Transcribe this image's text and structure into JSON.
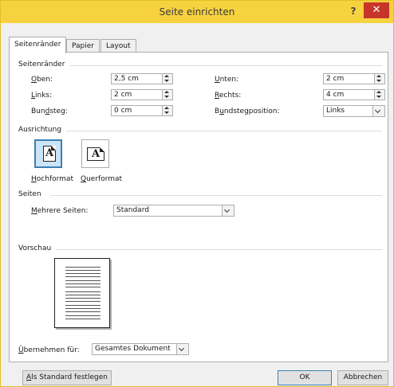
{
  "window": {
    "title": "Seite einrichten",
    "help_label": "?",
    "close_label": "✕"
  },
  "tabs": [
    {
      "label": "Seitenränder",
      "active": true
    },
    {
      "label": "Papier",
      "active": false
    },
    {
      "label": "Layout",
      "active": false
    }
  ],
  "margins": {
    "section": "Seitenränder",
    "top": {
      "label_u": "O",
      "label_rest": "ben:",
      "value": "2,5 cm"
    },
    "left": {
      "label_u": "L",
      "label_rest": "inks:",
      "value": "2 cm"
    },
    "gutter": {
      "label_pre": "Bun",
      "label_u": "d",
      "label_rest": "steg:",
      "value": "0 cm"
    },
    "bottom": {
      "label_u": "U",
      "label_rest": "nten:",
      "value": "2 cm"
    },
    "right": {
      "label_u": "R",
      "label_rest": "echts:",
      "value": "4 cm"
    },
    "gutter_position": {
      "label_pre": "B",
      "label_u": "u",
      "label_rest": "ndstegposition:",
      "value": "Links"
    }
  },
  "orientation": {
    "section": "Ausrichtung",
    "glyph": "A",
    "portrait": {
      "label_u": "H",
      "label_rest": "ochformat",
      "selected": true
    },
    "landscape": {
      "label_u": "Q",
      "label_rest": "uerformat",
      "selected": false
    }
  },
  "pages": {
    "section": "Seiten",
    "multiple": {
      "label_u": "M",
      "label_rest": "ehrere Seiten:",
      "value": "Standard"
    }
  },
  "preview": {
    "section": "Vorschau"
  },
  "apply": {
    "label_u": "Ü",
    "label_rest": "bernehmen für:",
    "value": "Gesamtes Dokument"
  },
  "buttons": {
    "default_u": "A",
    "default_rest": "ls Standard festlegen",
    "ok": "OK",
    "cancel": "Abbrechen"
  }
}
